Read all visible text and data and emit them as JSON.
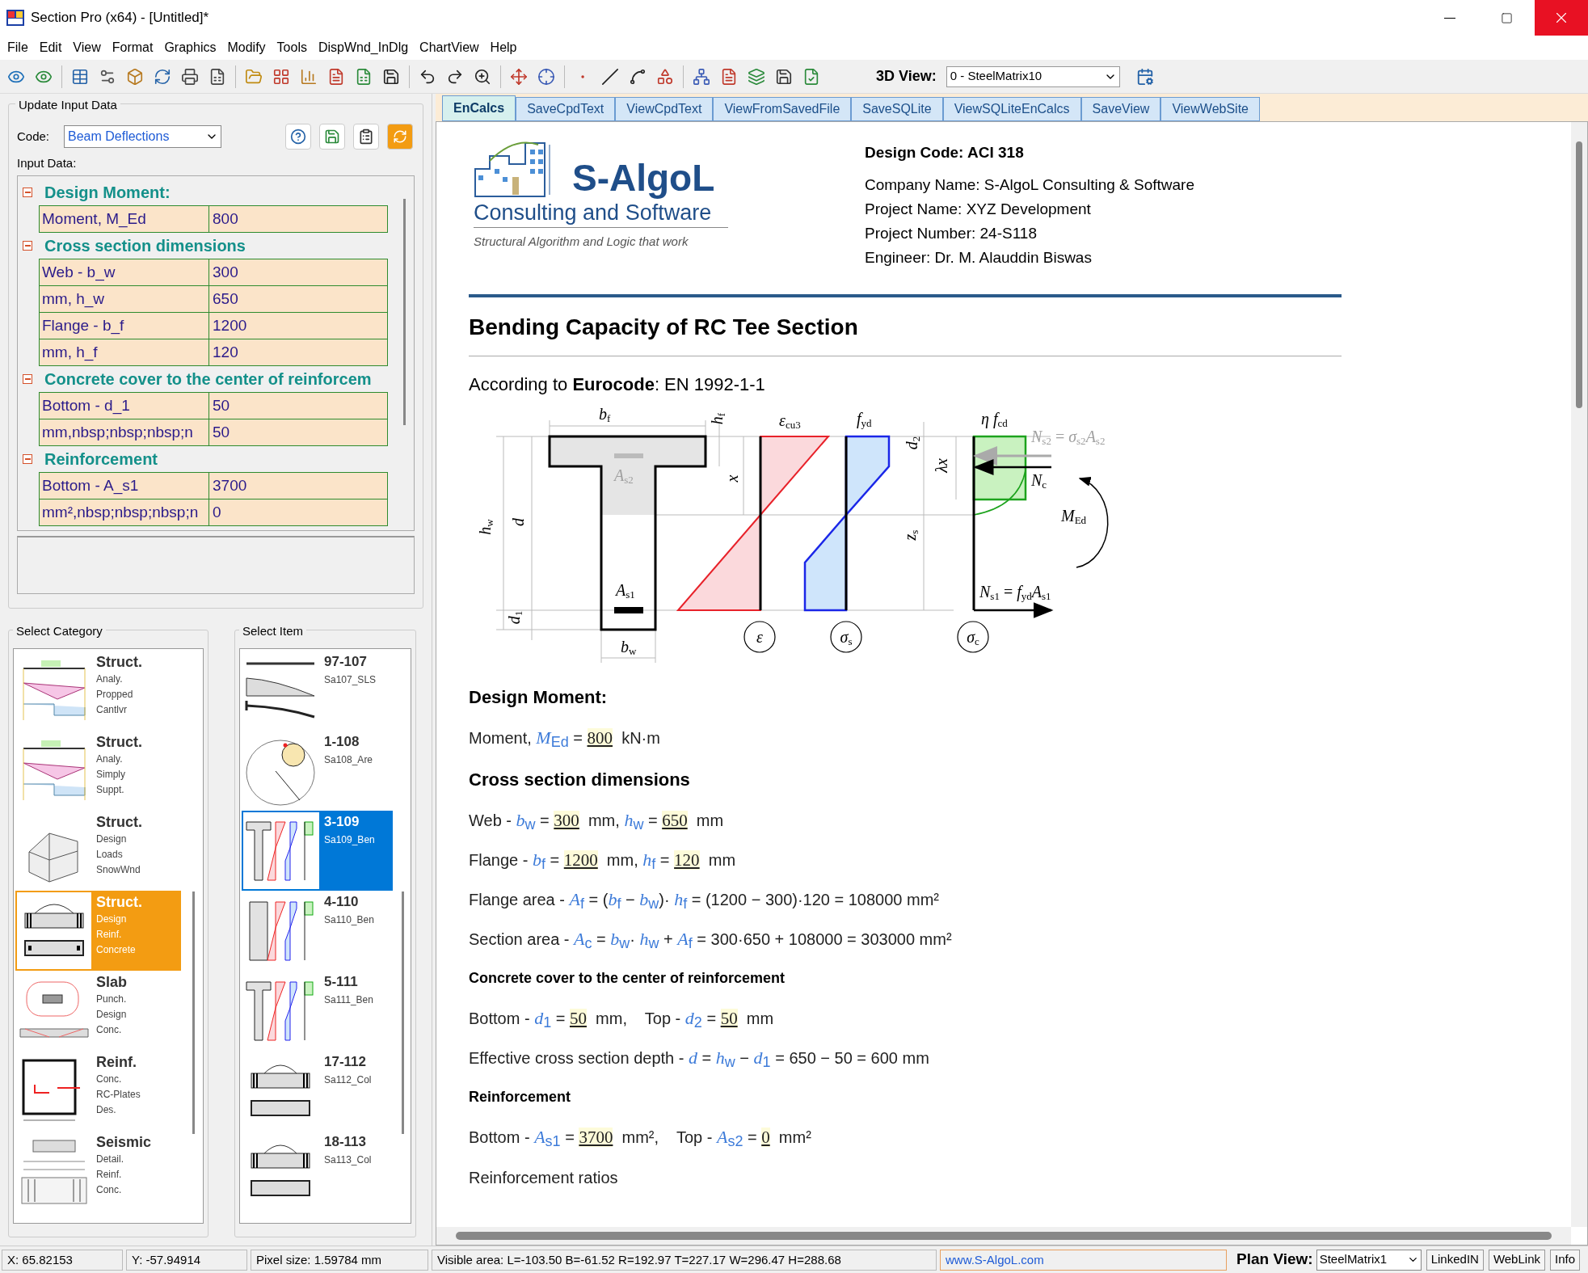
{
  "window": {
    "title": "Section Pro (x64) - [Untitled]*"
  },
  "menu": [
    "File",
    "Edit",
    "View",
    "Format",
    "Graphics",
    "Modify",
    "Tools",
    "DispWnd_InDlg",
    "ChartView",
    "Help"
  ],
  "toolbar": {
    "view3d_label": "3D View:",
    "view3d_value": "0 - SteelMatrix10"
  },
  "tabs": [
    {
      "label": "EnCalcs",
      "selected": true
    },
    {
      "label": "SaveCpdText",
      "selected": false
    },
    {
      "label": "ViewCpdText",
      "selected": false
    },
    {
      "label": "ViewFromSavedFile",
      "selected": false
    },
    {
      "label": "SaveSQLite",
      "selected": false
    },
    {
      "label": "ViewSQLiteEnCalcs",
      "selected": false
    },
    {
      "label": "SaveView",
      "selected": false
    },
    {
      "label": "ViewWebSite",
      "selected": false
    }
  ],
  "input_panel": {
    "title": "Update Input Data",
    "code_label": "Code:",
    "code_value": "Beam Deflections",
    "input_label": "Input Data:",
    "groups": [
      {
        "title": "Design Moment:",
        "expanded": true,
        "rows": [
          {
            "label": "Moment,  M_Ed",
            "value": "800"
          }
        ]
      },
      {
        "title": "Cross section dimensions",
        "expanded": true,
        "rows": [
          {
            "label": "Web - b_w",
            "value": "300"
          },
          {
            "label": "mm, h_w",
            "value": "650"
          },
          {
            "label": "Flange - b_f",
            "value": "1200"
          },
          {
            "label": "mm, h_f",
            "value": "120"
          }
        ]
      },
      {
        "title": "Concrete cover to the center of reinforcem",
        "expanded": true,
        "rows": [
          {
            "label": "Bottom - d_1",
            "value": "50"
          },
          {
            "label": "mm,nbsp;nbsp;nbsp;n",
            "value": "50"
          }
        ]
      },
      {
        "title": "Reinforcement",
        "expanded": true,
        "rows": [
          {
            "label": "Bottom - A_s1",
            "value": "3700"
          },
          {
            "label": "mm²,nbsp;nbsp;nbsp;n",
            "value": "0"
          }
        ]
      }
    ]
  },
  "category_panel": {
    "title": "Select Category",
    "items": [
      {
        "title": "Struct.",
        "lines": [
          "Analy.",
          "Propped",
          "Cantlvr"
        ],
        "selected": false
      },
      {
        "title": "Struct.",
        "lines": [
          "Analy.",
          "Simply",
          "Suppt."
        ],
        "selected": false
      },
      {
        "title": "Struct.",
        "lines": [
          "Design",
          "Loads",
          "SnowWnd"
        ],
        "selected": false
      },
      {
        "title": "Struct.",
        "lines": [
          "Design",
          "Reinf.",
          "Concrete"
        ],
        "selected": true
      },
      {
        "title": "Slab",
        "lines": [
          "Punch.",
          "Design",
          "Conc."
        ],
        "selected": false
      },
      {
        "title": "Reinf.",
        "lines": [
          "Conc.",
          "RC-Plates",
          "Des."
        ],
        "selected": false
      },
      {
        "title": "Seismic",
        "lines": [
          "Detail.",
          "Reinf.",
          "Conc."
        ],
        "selected": false
      }
    ]
  },
  "item_panel": {
    "title": "Select Item",
    "items": [
      {
        "number": "97-107",
        "name": "Sa107_SLS",
        "selected": false
      },
      {
        "number": "1-108",
        "name": "Sa108_Are",
        "selected": false
      },
      {
        "number": "3-109",
        "name": "Sa109_Ben",
        "selected": true
      },
      {
        "number": "4-110",
        "name": "Sa110_Ben",
        "selected": false
      },
      {
        "number": "5-111",
        "name": "Sa111_Ben",
        "selected": false
      },
      {
        "number": "17-112",
        "name": "Sa112_Col",
        "selected": false
      },
      {
        "number": "18-113",
        "name": "Sa113_Col",
        "selected": false
      }
    ]
  },
  "document": {
    "logo": {
      "name": "S-AlgoL",
      "subtitle": "Consulting and Software",
      "tagline": "Structural Algorithm and Logic that work"
    },
    "info": [
      {
        "kind": "heading",
        "text": "Design Code: ACI 318"
      },
      {
        "kind": "line",
        "text": "Company Name: S-AlgoL Consulting & Software"
      },
      {
        "kind": "line",
        "text": "Project Name: XYZ Development"
      },
      {
        "kind": "line",
        "text": "Project Number: 24-S118"
      },
      {
        "kind": "line",
        "text": "Engineer: Dr. M. Alauddin Biswas"
      }
    ],
    "title": "Bending Capacity of RC Tee Section",
    "intro": "According to **Eurocode**: EN 1992-1-1",
    "diagram_labels": [
      {
        "text": "*b*$_{f}$",
        "faded": false
      },
      {
        "text": "*h*$_{f}$",
        "faded": false
      },
      {
        "text": "*ε*$_{cu3}$",
        "faded": false
      },
      {
        "text": "*f*$_{yd}$",
        "faded": false
      },
      {
        "text": "*η f*$_{cd}$",
        "faded": false
      },
      {
        "text": "*N*$_{s2}$ = *σ*$_{s2}$*A*$_{s2}$",
        "faded": true
      },
      {
        "text": "*A*$_{s2}$",
        "faded": true
      },
      {
        "text": "*x*",
        "faded": false
      },
      {
        "text": "*λx*",
        "faded": false
      },
      {
        "text": "*d*$_{2}$",
        "faded": false
      },
      {
        "text": "*N*$_{c}$",
        "faded": false
      },
      {
        "text": "*M*$_{Ed}$",
        "faded": false
      },
      {
        "text": "*h*$_{w}$",
        "faded": false
      },
      {
        "text": "*d*",
        "faded": false
      },
      {
        "text": "*z*$_{s}$",
        "faded": false
      },
      {
        "text": "*A*$_{s1}$",
        "faded": false
      },
      {
        "text": "*N*$_{s1}$ = *f*$_{yd}$*A*$_{s1}$",
        "faded": false
      },
      {
        "text": "*d*$_{1}$",
        "faded": false
      },
      {
        "text": "*b*$_{w}$",
        "faded": false
      },
      {
        "text": "*ε*",
        "faded": false
      },
      {
        "text": "*σ*$_{s}$",
        "faded": false
      },
      {
        "text": "*σ*$_{c}$",
        "faded": false
      }
    ],
    "blocks": [
      {
        "kind": "heading",
        "text": "Design Moment:"
      },
      {
        "kind": "formula",
        "parts": [
          {
            "kind": "text",
            "text": "Moment, "
          },
          {
            "kind": "var",
            "text": "M$_{Ed}$"
          },
          {
            "kind": "text",
            "text": " = "
          },
          {
            "kind": "input",
            "text": "800"
          },
          {
            "kind": "text",
            "text": "  kN·m"
          }
        ]
      },
      {
        "kind": "heading",
        "text": "Cross section dimensions"
      },
      {
        "kind": "formula",
        "parts": [
          {
            "kind": "text",
            "text": "Web - "
          },
          {
            "kind": "var",
            "text": "b$_{w}$"
          },
          {
            "kind": "text",
            "text": " = "
          },
          {
            "kind": "input",
            "text": "300"
          },
          {
            "kind": "text",
            "text": "  mm, "
          },
          {
            "kind": "var",
            "text": "h$_{w}$"
          },
          {
            "kind": "text",
            "text": " = "
          },
          {
            "kind": "input",
            "text": "650"
          },
          {
            "kind": "text",
            "text": "  mm"
          }
        ]
      },
      {
        "kind": "formula",
        "parts": [
          {
            "kind": "text",
            "text": "Flange - "
          },
          {
            "kind": "var",
            "text": "b$_{f}$"
          },
          {
            "kind": "text",
            "text": " = "
          },
          {
            "kind": "input",
            "text": "1200"
          },
          {
            "kind": "text",
            "text": "  mm, "
          },
          {
            "kind": "var",
            "text": "h$_{f}$"
          },
          {
            "kind": "text",
            "text": " = "
          },
          {
            "kind": "input",
            "text": "120"
          },
          {
            "kind": "text",
            "text": "  mm"
          }
        ]
      },
      {
        "kind": "formula",
        "parts": [
          {
            "kind": "text",
            "text": "Flange area - "
          },
          {
            "kind": "var",
            "text": "A$_{f}$"
          },
          {
            "kind": "text",
            "text": " = ("
          },
          {
            "kind": "var",
            "text": "b$_{f}$"
          },
          {
            "kind": "text",
            "text": " − "
          },
          {
            "kind": "var",
            "text": "b$_{w}$"
          },
          {
            "kind": "text",
            "text": ")· "
          },
          {
            "kind": "var",
            "text": "h$_{f}$"
          },
          {
            "kind": "text",
            "text": " = (1200 − 300)·120 = 108000 mm²"
          }
        ]
      },
      {
        "kind": "formula",
        "parts": [
          {
            "kind": "text",
            "text": "Section area - "
          },
          {
            "kind": "var",
            "text": "A$_{c}$"
          },
          {
            "kind": "text",
            "text": " = "
          },
          {
            "kind": "var",
            "text": "b$_{w}$"
          },
          {
            "kind": "text",
            "text": "· "
          },
          {
            "kind": "var",
            "text": "h$_{w}$"
          },
          {
            "kind": "text",
            "text": " + "
          },
          {
            "kind": "var",
            "text": "A$_{f}$"
          },
          {
            "kind": "text",
            "text": " = 300·650 + 108000 = 303000 mm²"
          }
        ]
      },
      {
        "kind": "subheading",
        "text": "Concrete cover to the center of reinforcement"
      },
      {
        "kind": "formula",
        "parts": [
          {
            "kind": "text",
            "text": "Bottom - "
          },
          {
            "kind": "var",
            "text": "d$_{1}$"
          },
          {
            "kind": "text",
            "text": " = "
          },
          {
            "kind": "input",
            "text": "50"
          },
          {
            "kind": "text",
            "text": "  mm,    Top - "
          },
          {
            "kind": "var",
            "text": "d$_{2}$"
          },
          {
            "kind": "text",
            "text": " = "
          },
          {
            "kind": "input",
            "text": "50"
          },
          {
            "kind": "text",
            "text": "  mm"
          }
        ]
      },
      {
        "kind": "formula",
        "parts": [
          {
            "kind": "text",
            "text": "Effective cross section depth - "
          },
          {
            "kind": "var",
            "text": "d"
          },
          {
            "kind": "text",
            "text": " = "
          },
          {
            "kind": "var",
            "text": "h$_{w}$"
          },
          {
            "kind": "text",
            "text": " − "
          },
          {
            "kind": "var",
            "text": "d$_{1}$"
          },
          {
            "kind": "text",
            "text": " = 650 − 50 = 600 mm"
          }
        ]
      },
      {
        "kind": "subheading",
        "text": "Reinforcement"
      },
      {
        "kind": "formula",
        "parts": [
          {
            "kind": "text",
            "text": "Bottom - "
          },
          {
            "kind": "var",
            "text": "A$_{s1}$"
          },
          {
            "kind": "text",
            "text": " = "
          },
          {
            "kind": "input",
            "text": "3700"
          },
          {
            "kind": "text",
            "text": "  mm²,    Top - "
          },
          {
            "kind": "var",
            "text": "A$_{s2}$"
          },
          {
            "kind": "text",
            "text": " = "
          },
          {
            "kind": "input",
            "text": "0"
          },
          {
            "kind": "text",
            "text": "  mm²"
          }
        ]
      },
      {
        "kind": "paragraph",
        "text": "Reinforcement ratios"
      }
    ]
  },
  "status_bar": {
    "fields": [
      "X: 65.82153",
      "Y: -57.94914",
      "Pixel size: 1.59784 mm",
      "Visible area:  L=-103.50  B=-61.52  R=192.97  T=227.17  W=296.47  H=288.68"
    ],
    "link": "www.S-AlgoL.com",
    "plan_view_label": "Plan View:",
    "plan_view_value": "SteelMatrix1",
    "buttons": [
      "LinkedIN",
      "WebLink",
      "Info"
    ]
  }
}
